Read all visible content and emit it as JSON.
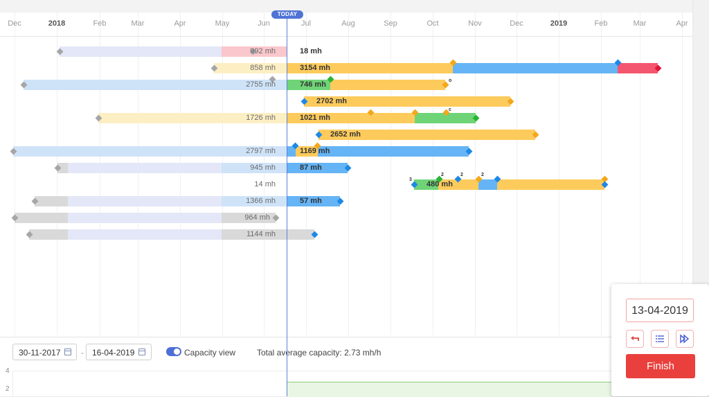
{
  "timeline": {
    "today_label": "TODAY",
    "months": [
      {
        "label": "Dec",
        "year": false
      },
      {
        "label": "2018",
        "year": true
      },
      {
        "label": "Feb",
        "year": false
      },
      {
        "label": "Mar",
        "year": false
      },
      {
        "label": "Apr",
        "year": false
      },
      {
        "label": "May",
        "year": false
      },
      {
        "label": "Jun",
        "year": false
      },
      {
        "label": "Jul",
        "year": false
      },
      {
        "label": "Aug",
        "year": false
      },
      {
        "label": "Sep",
        "year": false
      },
      {
        "label": "Oct",
        "year": false
      },
      {
        "label": "Nov",
        "year": false
      },
      {
        "label": "Dec",
        "year": false
      },
      {
        "label": "2019",
        "year": true
      },
      {
        "label": "Feb",
        "year": false
      },
      {
        "label": "Mar",
        "year": false
      },
      {
        "label": "Apr",
        "year": false
      }
    ]
  },
  "tasks": [
    {
      "pre_label": "992 mh",
      "post_label": "18 mh"
    },
    {
      "pre_label": "858 mh",
      "post_label": "3154 mh"
    },
    {
      "pre_label": "2755 mh",
      "post_label": "746 mh"
    },
    {
      "pre_label": "",
      "post_label": "2702 mh"
    },
    {
      "pre_label": "1726 mh",
      "post_label": "1021 mh"
    },
    {
      "pre_label": "",
      "post_label": "2652 mh"
    },
    {
      "pre_label": "2797 mh",
      "post_label": "1169 mh"
    },
    {
      "pre_label": "945 mh",
      "post_label": "87 mh"
    },
    {
      "pre_label": "14 mh",
      "post_label": "480 mh"
    },
    {
      "pre_label": "1366 mh",
      "post_label": "57 mh"
    },
    {
      "pre_label": "964 mh",
      "post_label": ""
    },
    {
      "pre_label": "1144 mh",
      "post_label": ""
    }
  ],
  "markers": {
    "o": "o",
    "c": "c",
    "two": "2",
    "three": "3"
  },
  "colors": {
    "past_blue": "#e3e7f7",
    "past_pink": "#f9c7cc",
    "past_yellow": "#fdefc4",
    "past_lightblue": "#cfe3f8",
    "past_grey": "#d9d9d9",
    "gold": "#fdcb5c",
    "blue": "#65b4f5",
    "green": "#6fd477",
    "red": "#f4566f",
    "diamond_blue": "#1e88e5",
    "diamond_gold": "#f3a81b",
    "diamond_green": "#2bb335",
    "diamond_grey": "#a6a6a6",
    "diamond_red": "#e3143b"
  },
  "filters": {
    "start_date": "30-11-2017",
    "separator": "-",
    "end_date": "16-04-2019",
    "capacity_toggle_label": "Capacity view",
    "capacity_toggle_on": true,
    "total_capacity": "Total average capacity: 2.73 mh/h"
  },
  "capacity_axis": {
    "ticks": [
      "4",
      "2"
    ]
  },
  "popup": {
    "date": "13-04-2019",
    "undo_icon": "undo-icon",
    "list_icon": "list-icon",
    "fast_forward_icon": "fast-forward-icon",
    "finish_label": "Finish"
  }
}
